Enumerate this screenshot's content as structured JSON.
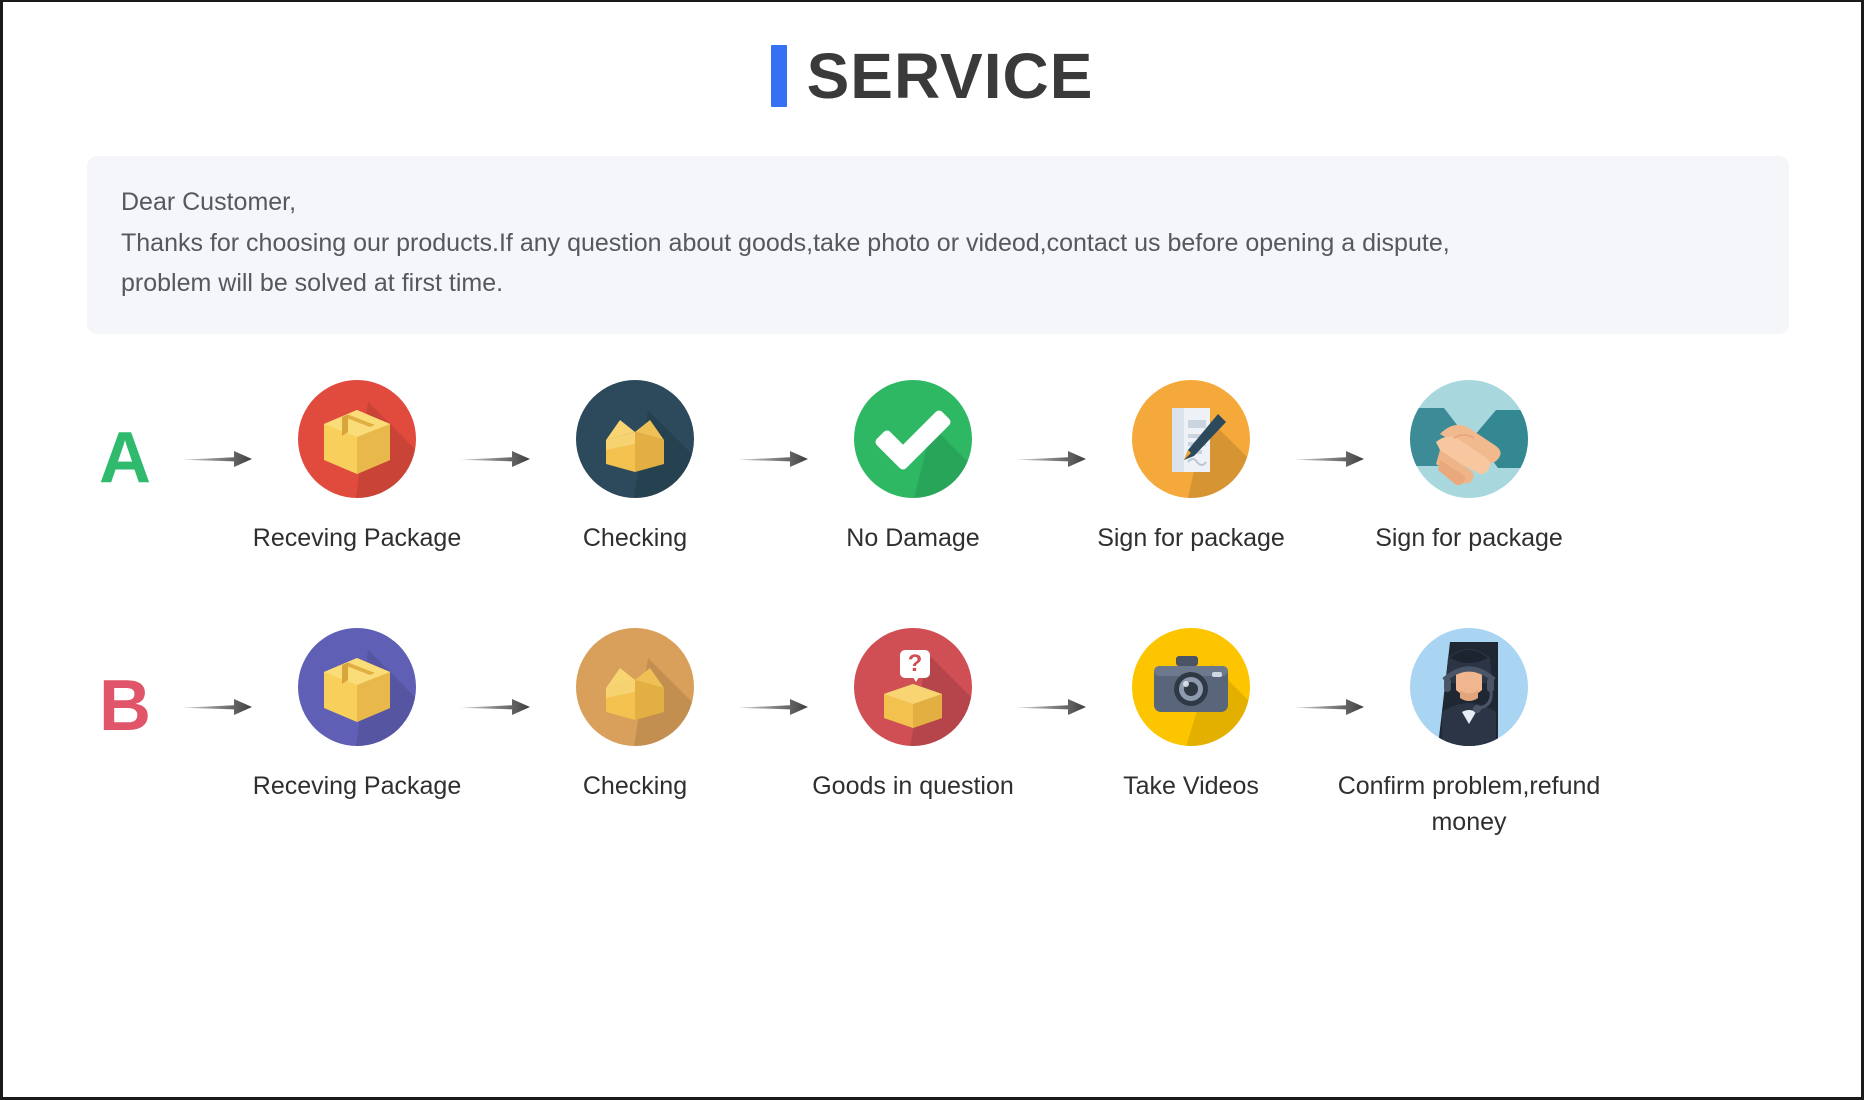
{
  "header": {
    "title": "SERVICE",
    "accent_color": "#3670f5",
    "title_color": "#3a3a3a"
  },
  "notice": {
    "background": "#f4f6fa",
    "lines": [
      "Dear Customer,",
      "Thanks for choosing our products.If any question about goods,take photo or videod,contact us before opening a dispute,",
      "problem will be solved at first time."
    ]
  },
  "flows": [
    {
      "letter": "A",
      "letter_color": "#2fba6d",
      "steps": [
        {
          "label": "Receving Package",
          "icon": "package-box-icon",
          "circle_color": "#e04b3e"
        },
        {
          "label": "Checking",
          "icon": "open-box-icon",
          "circle_color": "#2c4a5c"
        },
        {
          "label": "No Damage",
          "icon": "checkmark-icon",
          "circle_color": "#2eb864"
        },
        {
          "label": "Sign for package",
          "icon": "document-pen-icon",
          "circle_color": "#f5a93a"
        },
        {
          "label": "Sign for package",
          "icon": "handshake-icon",
          "circle_color": "#a8d8dd"
        }
      ]
    },
    {
      "letter": "B",
      "letter_color": "#e0556a",
      "steps": [
        {
          "label": "Receving Package",
          "icon": "package-box-icon",
          "circle_color": "#5f5fb5"
        },
        {
          "label": "Checking",
          "icon": "open-box-icon",
          "circle_color": "#d9a05b"
        },
        {
          "label": "Goods in question",
          "icon": "question-box-icon",
          "circle_color": "#cf4f55"
        },
        {
          "label": "Take Videos",
          "icon": "camera-icon",
          "circle_color": "#fdc500"
        },
        {
          "label": "Confirm problem,refund money",
          "icon": "support-agent-icon",
          "circle_color": "#a9d5f2"
        }
      ]
    }
  ],
  "arrow": {
    "name": "right-arrow-icon",
    "color": "#4a4a4a"
  }
}
